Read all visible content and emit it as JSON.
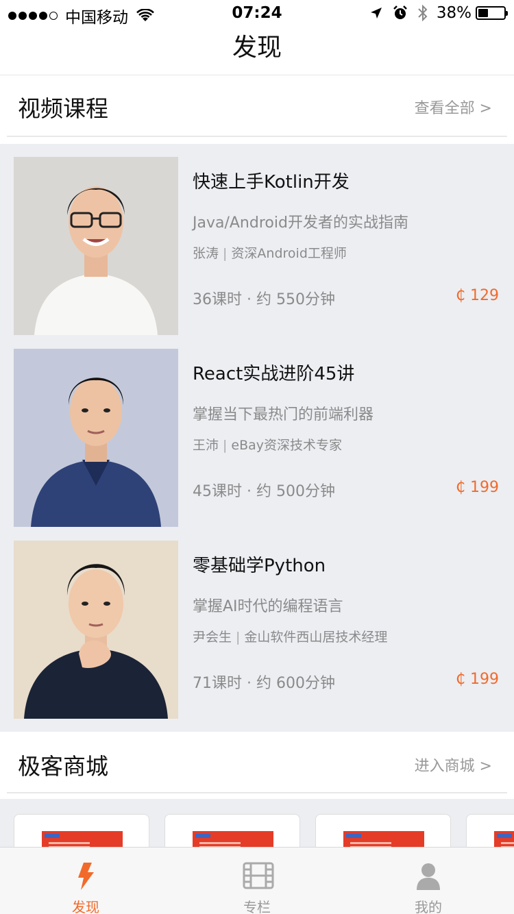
{
  "status_bar": {
    "carrier": "中国移动",
    "time": "07:24",
    "battery": "38%"
  },
  "nav": {
    "title": "发现"
  },
  "video_section": {
    "title": "视频课程",
    "link": "查看全部 >"
  },
  "courses": [
    {
      "title": "快速上手Kotlin开发",
      "subtitle": "Java/Android开发者的实战指南",
      "author": "张涛",
      "author_role": "资深Android工程师",
      "meta": "36课时 · 约 550分钟",
      "price": "₵ 129"
    },
    {
      "title": "React实战进阶45讲",
      "subtitle": "掌握当下最热门的前端利器",
      "author": "王沛",
      "author_role": "eBay资深技术专家",
      "meta": "45课时 · 约 500分钟",
      "price": "₵ 199"
    },
    {
      "title": "零基础学Python",
      "subtitle": "掌握AI时代的编程语言",
      "author": "尹会生",
      "author_role": "金山软件西山居技术经理",
      "meta": "71课时 · 约 600分钟",
      "price": "₵ 199"
    }
  ],
  "store_section": {
    "title": "极客商城",
    "link": "进入商城 >"
  },
  "tabbar": {
    "tabs": [
      {
        "label": "发现"
      },
      {
        "label": "专栏"
      },
      {
        "label": "我的"
      }
    ]
  },
  "colors": {
    "accent": "#f26a2a",
    "background": "#eceef2",
    "muted": "#8a8a8a"
  }
}
